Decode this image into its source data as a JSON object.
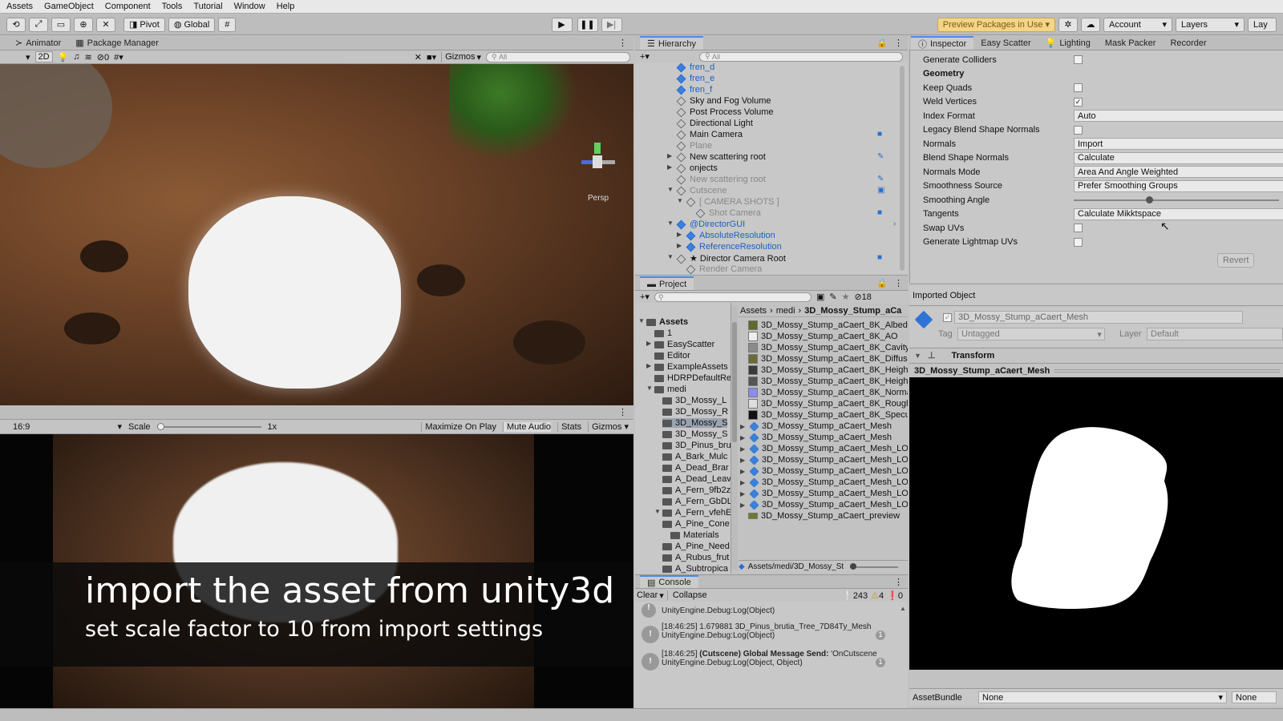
{
  "menu": [
    "Assets",
    "GameObject",
    "Component",
    "Tools",
    "Tutorial",
    "Window",
    "Help"
  ],
  "toolbar": {
    "pivot": "Pivot",
    "global": "Global",
    "preview_packages": "Preview Packages in Use",
    "account": "Account",
    "layers": "Layers",
    "layout": "Lay"
  },
  "scene": {
    "tabs": [
      "Animator",
      "Package Manager"
    ],
    "mode_2d": "2D",
    "hidden_count": "0",
    "gizmos": "Gizmos",
    "search_placeholder": "All",
    "persp": "Persp"
  },
  "game": {
    "aspect": "16:9",
    "scale_label": "Scale",
    "scale_value": "1x",
    "maximize": "Maximize On Play",
    "mute": "Mute Audio",
    "stats": "Stats",
    "gizmos": "Gizmos"
  },
  "caption": {
    "title": "import the asset from unity3d",
    "subtitle": "set scale factor to 10 from import settings"
  },
  "hierarchy": {
    "title": "Hierarchy",
    "search_placeholder": "All",
    "items": [
      {
        "label": "fren_d",
        "style": "blue",
        "indent": 0
      },
      {
        "label": "fren_e",
        "style": "blue",
        "indent": 0
      },
      {
        "label": "fren_f",
        "style": "blue",
        "indent": 0
      },
      {
        "label": "Sky and Fog Volume",
        "style": "normal",
        "indent": 0
      },
      {
        "label": "Post Process Volume",
        "style": "normal",
        "indent": 0
      },
      {
        "label": "Directional Light",
        "style": "normal",
        "indent": 0
      },
      {
        "label": "Main Camera",
        "style": "normal",
        "indent": 0
      },
      {
        "label": "Plane",
        "style": "grey",
        "indent": 0
      },
      {
        "label": "New scattering root",
        "style": "normal",
        "indent": 0
      },
      {
        "label": "onjects",
        "style": "normal",
        "indent": 0
      },
      {
        "label": "New scattering root",
        "style": "grey",
        "indent": 0
      },
      {
        "label": "Cutscene",
        "style": "grey",
        "indent": 0
      },
      {
        "label": "[ CAMERA SHOTS ]",
        "style": "grey",
        "indent": 1
      },
      {
        "label": "Shot Camera",
        "style": "grey",
        "indent": 2
      },
      {
        "label": "@DirectorGUI",
        "style": "blue",
        "indent": 0
      },
      {
        "label": "AbsoluteResolution",
        "style": "blue",
        "indent": 1
      },
      {
        "label": "ReferenceResolution",
        "style": "blue",
        "indent": 1
      },
      {
        "label": "★ Director Camera Root",
        "style": "normal",
        "indent": 0
      },
      {
        "label": "Render Camera",
        "style": "grey",
        "indent": 1
      }
    ]
  },
  "project": {
    "title": "Project",
    "hidden_count": "18",
    "breadcrumb": [
      "Assets",
      "medi",
      "3D_Mossy_Stump_aCa"
    ],
    "tree": [
      {
        "label": "Assets",
        "indent": 0,
        "bold": true
      },
      {
        "label": "1",
        "indent": 1
      },
      {
        "label": "EasyScatter",
        "indent": 1
      },
      {
        "label": "Editor",
        "indent": 1
      },
      {
        "label": "ExampleAssets",
        "indent": 1
      },
      {
        "label": "HDRPDefaultRe",
        "indent": 1
      },
      {
        "label": "medi",
        "indent": 1
      },
      {
        "label": "3D_Mossy_L",
        "indent": 2
      },
      {
        "label": "3D_Mossy_R",
        "indent": 2
      },
      {
        "label": "3D_Mossy_S",
        "indent": 2
      },
      {
        "label": "3D_Mossy_S",
        "indent": 2
      },
      {
        "label": "3D_Pinus_bru",
        "indent": 2
      },
      {
        "label": "A_Bark_Mulc",
        "indent": 2
      },
      {
        "label": "A_Dead_Brar",
        "indent": 2
      },
      {
        "label": "A_Dead_Leav",
        "indent": 2
      },
      {
        "label": "A_Fern_9fb2z",
        "indent": 2
      },
      {
        "label": "A_Fern_GbDL",
        "indent": 2
      },
      {
        "label": "A_Fern_vfehE",
        "indent": 2
      },
      {
        "label": "A_Pine_Cone",
        "indent": 2
      },
      {
        "label": "Materials",
        "indent": 3
      },
      {
        "label": "A_Pine_Need",
        "indent": 2
      },
      {
        "label": "A_Rubus_frut",
        "indent": 2
      },
      {
        "label": "A_Subtropica",
        "indent": 2
      }
    ],
    "files": [
      {
        "label": "3D_Mossy_Stump_aCaert_8K_Albedo",
        "kind": "tex",
        "color": "#5d6a2a"
      },
      {
        "label": "3D_Mossy_Stump_aCaert_8K_AO",
        "kind": "tex",
        "color": "#eeeeee"
      },
      {
        "label": "3D_Mossy_Stump_aCaert_8K_Cavity",
        "kind": "tex",
        "color": "#8a8a8a"
      },
      {
        "label": "3D_Mossy_Stump_aCaert_8K_Diffuse",
        "kind": "tex",
        "color": "#6b6a3a"
      },
      {
        "label": "3D_Mossy_Stump_aCaert_8K_Height",
        "kind": "tex",
        "color": "#3a3a3a"
      },
      {
        "label": "3D_Mossy_Stump_aCaert_8K_Height",
        "kind": "tex",
        "color": "#555555"
      },
      {
        "label": "3D_Mossy_Stump_aCaert_8K_Normal",
        "kind": "tex",
        "color": "#8a8cf0"
      },
      {
        "label": "3D_Mossy_Stump_aCaert_8K_Roughn",
        "kind": "tex",
        "color": "#dddddd"
      },
      {
        "label": "3D_Mossy_Stump_aCaert_8K_Specul",
        "kind": "tex",
        "color": "#111111"
      },
      {
        "label": "3D_Mossy_Stump_aCaert_Mesh",
        "kind": "mesh"
      },
      {
        "label": "3D_Mossy_Stump_aCaert_Mesh",
        "kind": "mesh"
      },
      {
        "label": "3D_Mossy_Stump_aCaert_Mesh_LOD",
        "kind": "mesh"
      },
      {
        "label": "3D_Mossy_Stump_aCaert_Mesh_LOD",
        "kind": "mesh"
      },
      {
        "label": "3D_Mossy_Stump_aCaert_Mesh_LOD",
        "kind": "mesh"
      },
      {
        "label": "3D_Mossy_Stump_aCaert_Mesh_LOD",
        "kind": "mesh"
      },
      {
        "label": "3D_Mossy_Stump_aCaert_Mesh_LOD",
        "kind": "mesh"
      },
      {
        "label": "3D_Mossy_Stump_aCaert_Mesh_LOD",
        "kind": "mesh"
      },
      {
        "label": "3D_Mossy_Stump_aCaert_preview",
        "kind": "prev"
      }
    ],
    "status_path": "Assets/medi/3D_Mossy_St"
  },
  "console": {
    "title": "Console",
    "clear": "Clear",
    "collapse": "Collapse",
    "count_log": "243",
    "count_warn": "4",
    "count_err": "0",
    "entries": [
      {
        "line1": "[18:46:25] 1.679881 3D_Pinus_brutia_Tree_7D84Ty_Mesh",
        "line2": "UnityEngine.Debug:Log(Object)",
        "line1_bold": ""
      },
      {
        "line1": "[18:46:25] ",
        "line1_bold": "(Cutscene) Global Message Send:",
        "line1_rest": " 'OnCutscene",
        "line2": "UnityEngine.Debug:Log(Object, Object)"
      }
    ],
    "partial_top": "UnityEngine.Debug:Log(Object)"
  },
  "inspector": {
    "tabs": [
      "Inspector",
      "Easy Scatter",
      "Lighting",
      "Mask Packer",
      "Recorder"
    ],
    "rows": [
      {
        "label": "Generate Colliders",
        "type": "check",
        "checked": false
      },
      {
        "label": "Geometry",
        "type": "header"
      },
      {
        "label": "Keep Quads",
        "type": "check",
        "checked": false
      },
      {
        "label": "Weld Vertices",
        "type": "check",
        "checked": true
      },
      {
        "label": "Index Format",
        "type": "select",
        "value": "Auto"
      },
      {
        "label": "Legacy Blend Shape Normals",
        "type": "check",
        "checked": false
      },
      {
        "label": "Normals",
        "type": "select",
        "value": "Import"
      },
      {
        "label": "Blend Shape Normals",
        "type": "select",
        "value": "Calculate"
      },
      {
        "label": "Normals Mode",
        "type": "select",
        "value": "Area And Angle Weighted"
      },
      {
        "label": "Smoothness Source",
        "type": "select",
        "value": "Prefer Smoothing Groups"
      },
      {
        "label": "Smoothing Angle",
        "type": "slider",
        "fraction": 0.35
      },
      {
        "label": "Tangents",
        "type": "select",
        "value": "Calculate Mikktspace"
      },
      {
        "label": "Swap UVs",
        "type": "check",
        "checked": false
      },
      {
        "label": "Generate Lightmap UVs",
        "type": "check",
        "checked": false
      }
    ],
    "revert": "Revert",
    "imported_object": "Imported Object",
    "object_name": "3D_Mossy_Stump_aCaert_Mesh",
    "tag_label": "Tag",
    "tag_value": "Untagged",
    "layer_label": "Layer",
    "layer_value": "Default",
    "transform": "Transform",
    "preview_title": "3D_Mossy_Stump_aCaert_Mesh",
    "assetbundle_label": "AssetBundle",
    "assetbundle_value": "None",
    "assetbundle_variant": "None"
  }
}
